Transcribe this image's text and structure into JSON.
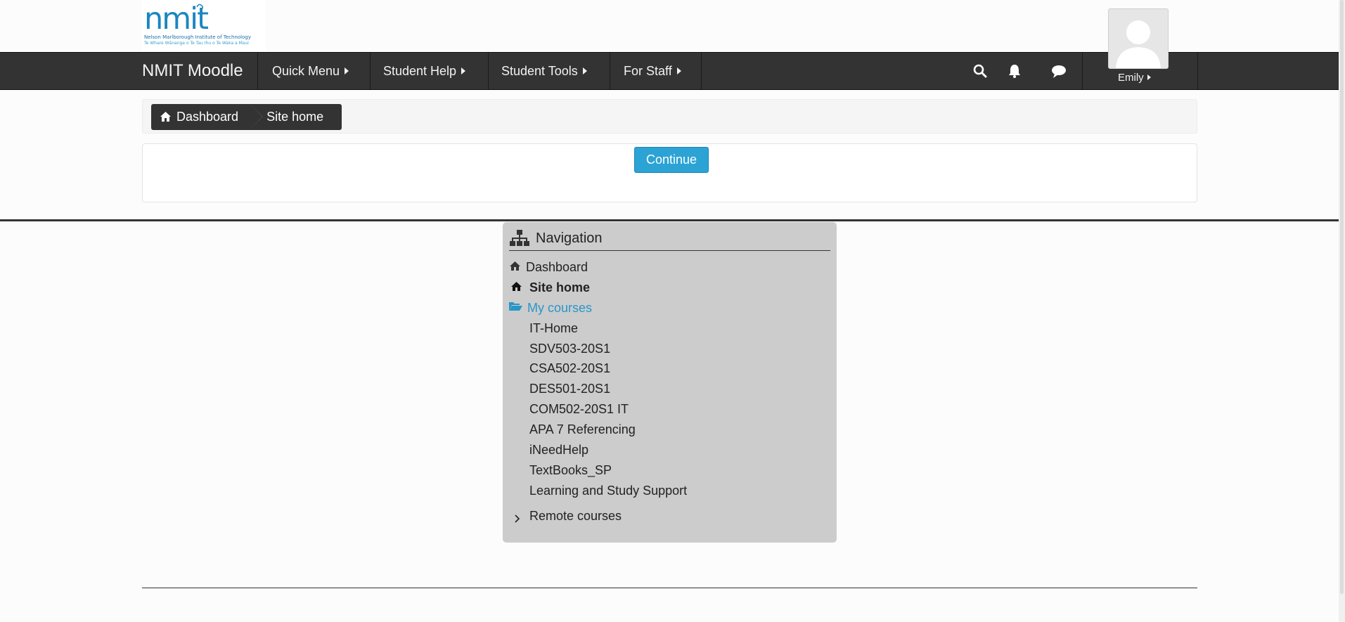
{
  "logo": {
    "word": "nmit",
    "tagline1": "Nelson Marlborough Institute of Technology",
    "tagline2": "Te Whare Wānanga o Te Tau Ihu o Te Waka a Maui"
  },
  "navbar": {
    "brand": "NMIT Moodle",
    "menu": [
      {
        "label": "Quick Menu"
      },
      {
        "label": "Student Help"
      },
      {
        "label": "Student Tools"
      },
      {
        "label": "For Staff"
      }
    ],
    "icons": [
      "search-icon",
      "bell-icon",
      "chat-icon"
    ],
    "user_name": "Emily"
  },
  "breadcrumb": {
    "items": [
      "Dashboard",
      "Site home"
    ]
  },
  "continue_button": "Continue",
  "navigation_block": {
    "title": "Navigation",
    "dashboard": "Dashboard",
    "site_home": "Site home",
    "my_courses": "My courses",
    "courses": [
      "IT-Home",
      "SDV503-20S1",
      "CSA502-20S1",
      "DES501-20S1",
      "COM502-20S1 IT",
      "APA 7 Referencing",
      "iNeedHelp",
      "TextBooks_SP",
      "Learning and Study Support"
    ],
    "remote_courses": "Remote courses"
  },
  "colors": {
    "navbar_bg": "#333333",
    "accent_button": "#2ba3d4",
    "link": "#2996c8",
    "nav_block_bg": "#cccccc"
  }
}
